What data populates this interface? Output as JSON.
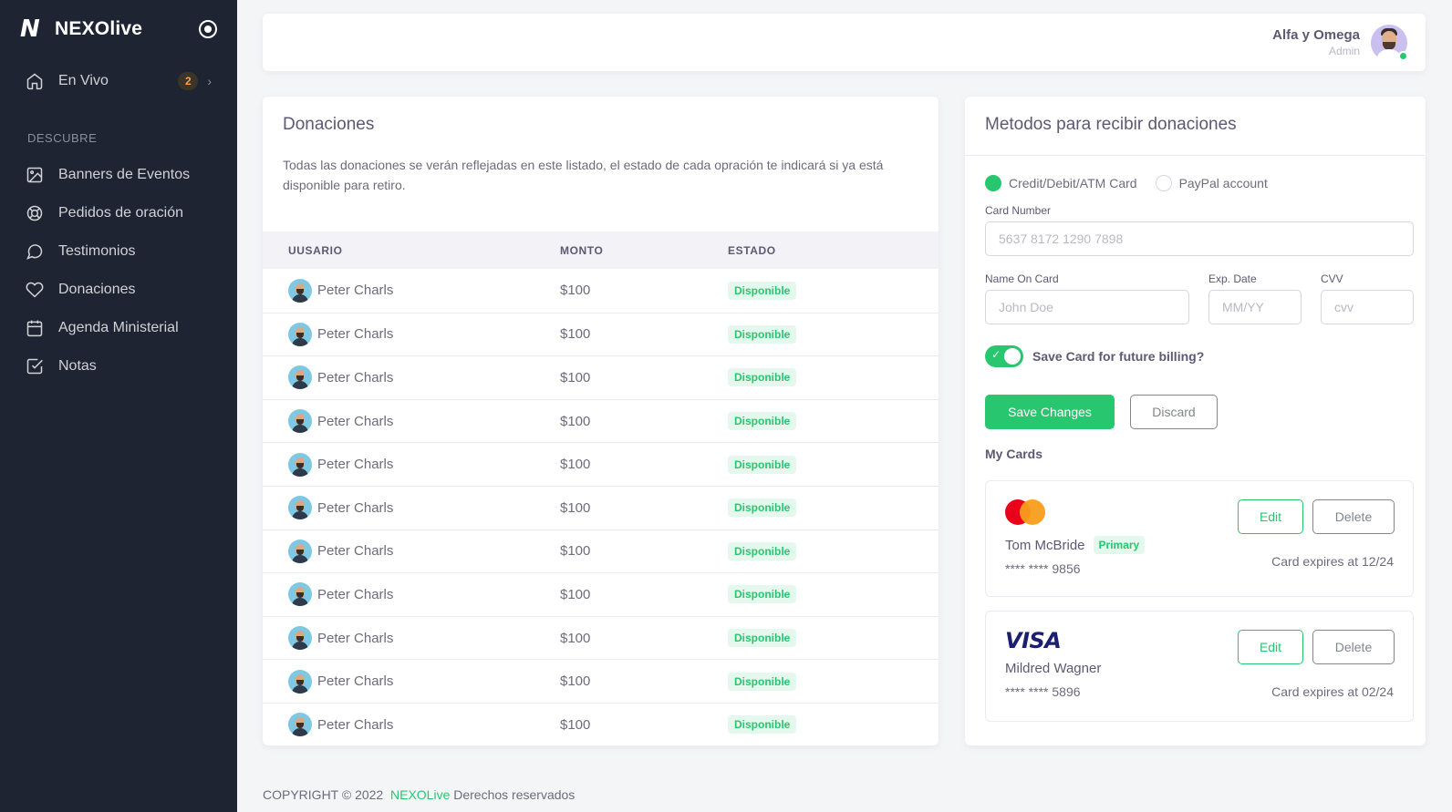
{
  "brand": {
    "name": "NEXOlive",
    "logo_letter": "N"
  },
  "sidebar": {
    "top_item": {
      "label": "En Vivo",
      "badge": "2",
      "icon": "home-icon"
    },
    "section_label": "DESCUBRE",
    "items": [
      {
        "label": "Banners de Eventos",
        "icon": "image-icon"
      },
      {
        "label": "Pedidos de oración",
        "icon": "life-buoy-icon"
      },
      {
        "label": "Testimonios",
        "icon": "message-circle-icon"
      },
      {
        "label": "Donaciones",
        "icon": "heart-icon"
      },
      {
        "label": "Agenda Ministerial",
        "icon": "calendar-icon"
      },
      {
        "label": "Notas",
        "icon": "check-square-icon"
      }
    ]
  },
  "header": {
    "user_name": "Alfa y Omega",
    "user_role": "Admin"
  },
  "donations": {
    "title": "Donaciones",
    "description": "Todas las donaciones se verán reflejadas en este listado, el estado de cada opración te indicará si ya está disponible para retiro.",
    "columns": [
      "UUSARIO",
      "MONTO",
      "ESTADO"
    ],
    "rows": [
      {
        "user": "Peter Charls",
        "amount": "$100",
        "status": "Disponible"
      },
      {
        "user": "Peter Charls",
        "amount": "$100",
        "status": "Disponible"
      },
      {
        "user": "Peter Charls",
        "amount": "$100",
        "status": "Disponible"
      },
      {
        "user": "Peter Charls",
        "amount": "$100",
        "status": "Disponible"
      },
      {
        "user": "Peter Charls",
        "amount": "$100",
        "status": "Disponible"
      },
      {
        "user": "Peter Charls",
        "amount": "$100",
        "status": "Disponible"
      },
      {
        "user": "Peter Charls",
        "amount": "$100",
        "status": "Disponible"
      },
      {
        "user": "Peter Charls",
        "amount": "$100",
        "status": "Disponible"
      },
      {
        "user": "Peter Charls",
        "amount": "$100",
        "status": "Disponible"
      },
      {
        "user": "Peter Charls",
        "amount": "$100",
        "status": "Disponible"
      },
      {
        "user": "Peter Charls",
        "amount": "$100",
        "status": "Disponible"
      }
    ]
  },
  "methods": {
    "title": "Metodos para recibir donaciones",
    "radio_card": "Credit/Debit/ATM Card",
    "radio_paypal": "PayPal account",
    "card_number_label": "Card Number",
    "card_number_placeholder": "5637 8172 1290 7898",
    "name_label": "Name On Card",
    "name_placeholder": "John Doe",
    "exp_label": "Exp. Date",
    "exp_placeholder": "MM/YY",
    "cvv_label": "CVV",
    "cvv_placeholder": "cvv",
    "save_card_label": "Save Card for future billing?",
    "save_button": "Save Changes",
    "discard_button": "Discard",
    "my_cards_label": "My Cards",
    "cards": [
      {
        "brand": "mastercard",
        "holder": "Tom McBride",
        "tag": "Primary",
        "number": "**** **** 9856",
        "expires": "Card expires at 12/24",
        "edit": "Edit",
        "delete": "Delete"
      },
      {
        "brand": "VISA",
        "holder": "Mildred Wagner",
        "number": "**** **** 5896",
        "expires": "Card expires at 02/24",
        "edit": "Edit",
        "delete": "Delete"
      }
    ]
  },
  "footer": {
    "prefix": "COPYRIGHT © 2022",
    "brand": "NEXOLive",
    "suffix": "Derechos reservados"
  },
  "colors": {
    "sidebar_bg": "#1f2433",
    "accent": "#28c76f",
    "badge_orange": "#ff9f43"
  }
}
